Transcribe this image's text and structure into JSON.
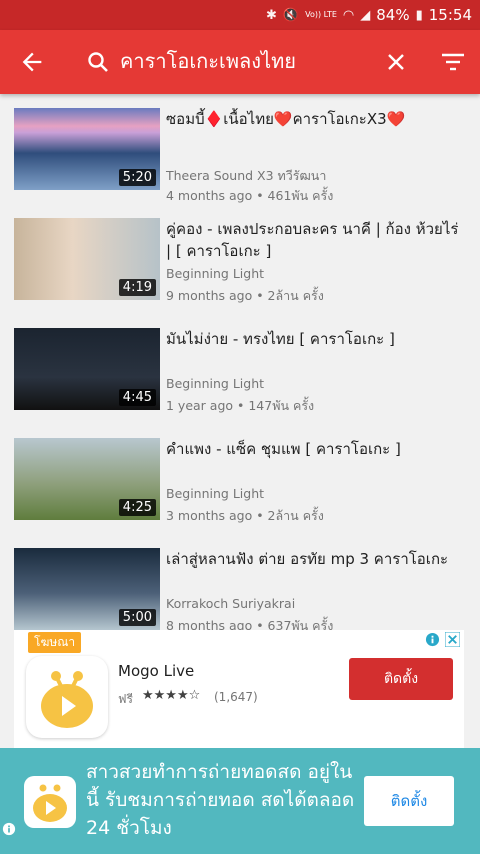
{
  "status_bar": {
    "volte": "Vo)) LTE",
    "battery": "84%",
    "time": "15:54"
  },
  "app_bar": {
    "query": "คาราโอเกะเพลงไทย"
  },
  "videos": [
    {
      "title": "ซอมบี้♦️เนื้อไทย❤️คาราโอเกะX3❤️",
      "channel": "Theera Sound X3 ทวีรัฒนา",
      "meta": "4 months ago • 461พัน ครั้ง",
      "duration": "5:20"
    },
    {
      "title": "คู่คอง - เพลงประกอบละคร นาคี | ก้อง ห้วยไร่ | [ คาราโอเกะ ]",
      "channel": "Beginning Light",
      "meta": "9 months ago • 2ล้าน ครั้ง",
      "duration": "4:19"
    },
    {
      "title": "มันไม่ง่าย - ทรงไทย [ คาราโอเกะ ]",
      "channel": "Beginning Light",
      "meta": "1 year ago • 147พัน ครั้ง",
      "duration": "4:45"
    },
    {
      "title": "คำแพง - แซ็ค ชุมแพ [ คาราโอเกะ ]",
      "channel": "Beginning Light",
      "meta": "3 months ago • 2ล้าน ครั้ง",
      "duration": "4:25"
    },
    {
      "title": "เล่าสู่หลานฟัง ต่าย อรทัย mp 3 คาราโอเกะ",
      "channel": "Korrakoch Suriyakrai",
      "meta": "8 months ago • 637พัน ครั้ง",
      "duration": "5:00"
    }
  ],
  "ad_card": {
    "badge": "โฆษณา",
    "app_name": "Mogo Live",
    "price": "ฟรี",
    "stars": "★★★★☆",
    "reviews": "(1,647)",
    "install": "ติดตั้ง"
  },
  "ad_banner": {
    "text": "สาวสวยทำการถ่ายทอดสด อยู่ในนี้ รับชมการถ่ายทอด สดได้ตลอด 24 ชั่วโมง",
    "install": "ติดตั้ง"
  }
}
